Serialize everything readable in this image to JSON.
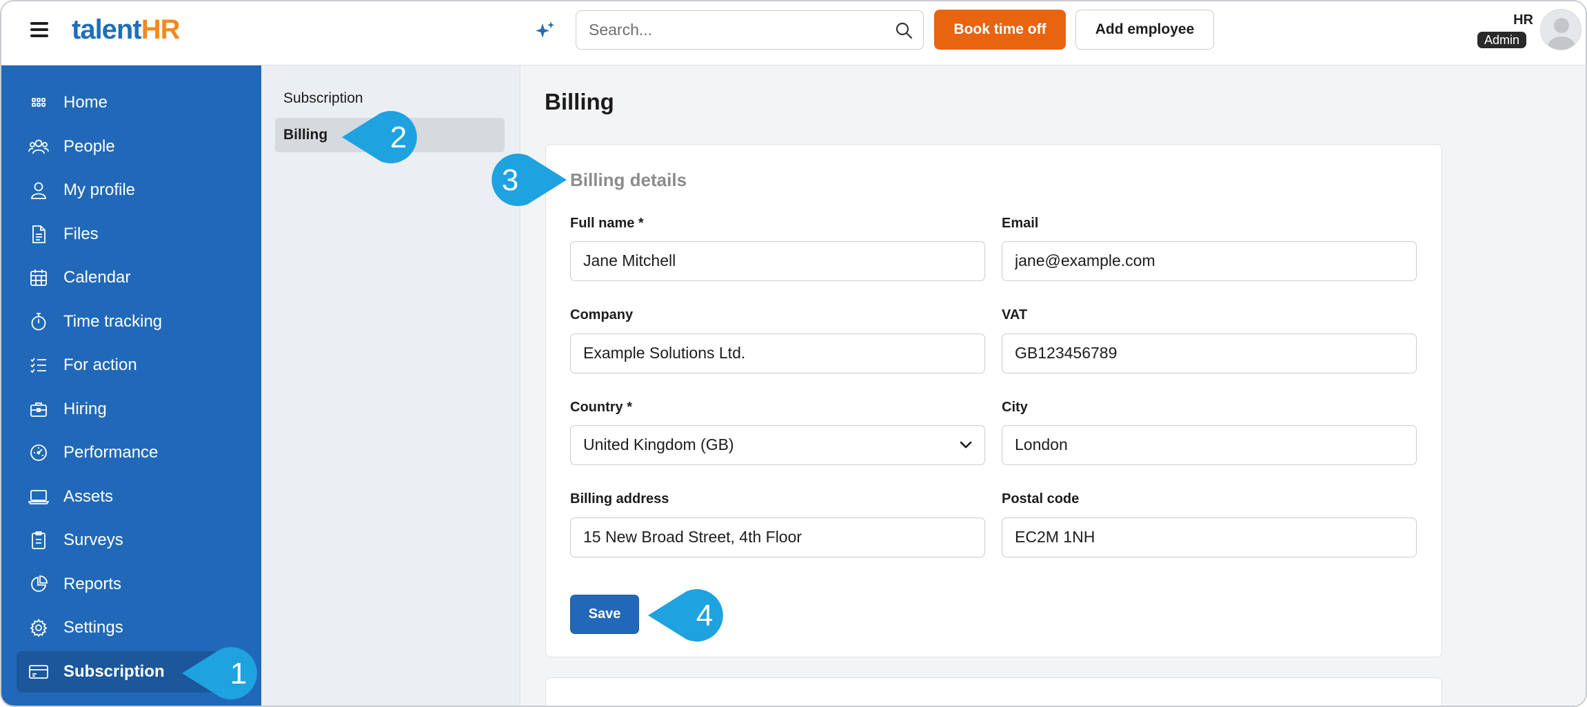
{
  "header": {
    "logo_part1": "talent",
    "logo_part2": "HR",
    "search_placeholder": "Search...",
    "book_time_off_label": "Book time off",
    "add_employee_label": "Add employee",
    "user_initials": "HR",
    "user_role": "Admin"
  },
  "sidebar": {
    "items": [
      {
        "label": "Home",
        "icon": "grid-icon"
      },
      {
        "label": "People",
        "icon": "people-icon"
      },
      {
        "label": "My profile",
        "icon": "user-icon"
      },
      {
        "label": "Files",
        "icon": "file-icon"
      },
      {
        "label": "Calendar",
        "icon": "calendar-icon"
      },
      {
        "label": "Time tracking",
        "icon": "stopwatch-icon"
      },
      {
        "label": "For action",
        "icon": "checklist-icon"
      },
      {
        "label": "Hiring",
        "icon": "briefcase-icon"
      },
      {
        "label": "Performance",
        "icon": "gauge-icon"
      },
      {
        "label": "Assets",
        "icon": "laptop-icon"
      },
      {
        "label": "Surveys",
        "icon": "clipboard-icon"
      },
      {
        "label": "Reports",
        "icon": "pie-chart-icon"
      },
      {
        "label": "Settings",
        "icon": "gear-icon"
      },
      {
        "label": "Subscription",
        "icon": "credit-card-icon",
        "active": true
      }
    ]
  },
  "subnav": {
    "items": [
      {
        "label": "Subscription"
      },
      {
        "label": "Billing",
        "active": true
      }
    ]
  },
  "main": {
    "page_title": "Billing",
    "section_title": "Billing details",
    "fields": {
      "full_name": {
        "label": "Full name *",
        "value": "Jane Mitchell"
      },
      "email": {
        "label": "Email",
        "value": "jane@example.com"
      },
      "company": {
        "label": "Company",
        "value": "Example Solutions Ltd."
      },
      "vat": {
        "label": "VAT",
        "value": "GB123456789"
      },
      "country": {
        "label": "Country *",
        "value": "United Kingdom (GB)"
      },
      "city": {
        "label": "City",
        "value": "London"
      },
      "billing_address": {
        "label": "Billing address",
        "value": "15 New Broad Street, 4th Floor"
      },
      "postal_code": {
        "label": "Postal code",
        "value": "EC2M 1NH"
      }
    },
    "save_label": "Save"
  },
  "callouts": [
    "1",
    "2",
    "3",
    "4"
  ],
  "colors": {
    "sidebar": "#2169b8",
    "accent_orange": "#e8640f",
    "callout": "#1ea2e0"
  }
}
